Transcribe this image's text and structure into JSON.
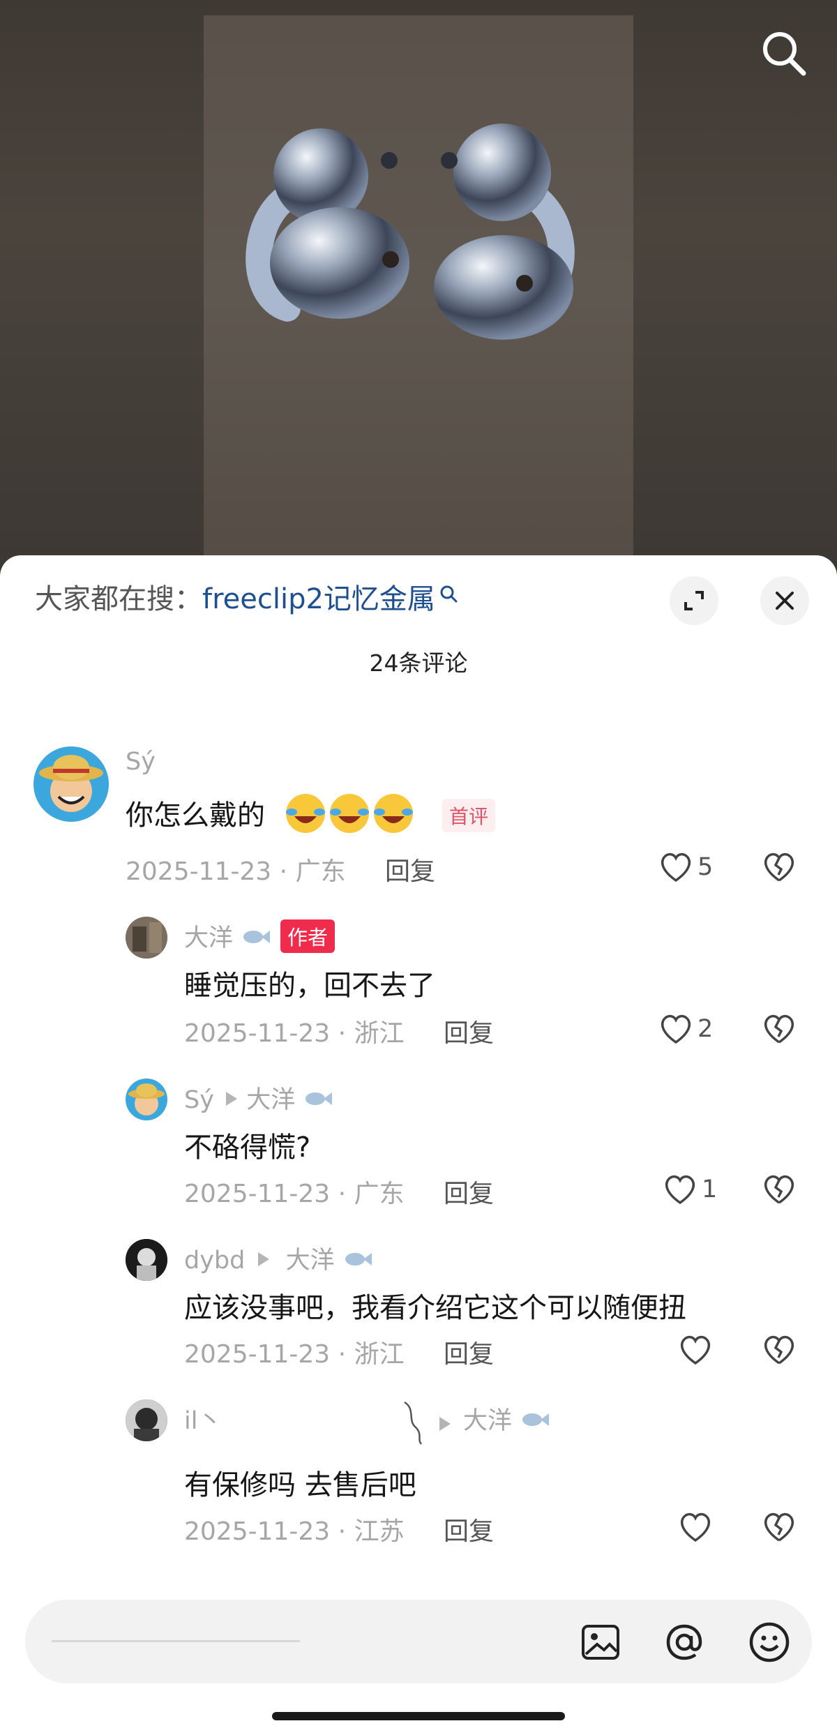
{
  "header": {
    "hot_search_prefix": "大家都在搜：",
    "hot_search_query": "freeclip2记忆金属",
    "comment_count": "24条评论"
  },
  "comments": [
    {
      "user": "Sý",
      "text": "你怎么戴的",
      "tag": "首评",
      "date": "2025-11-23",
      "location": "广东",
      "reply": "回复",
      "likes": "5"
    },
    {
      "user": "大洋",
      "tag": "作者",
      "text": "睡觉压的，回不去了",
      "date": "2025-11-23",
      "location": "浙江",
      "reply": "回复",
      "likes": "2"
    },
    {
      "user": "Sý",
      "reply_to": "大洋",
      "text": "不硌得慌?",
      "date": "2025-11-23",
      "location": "广东",
      "reply": "回复",
      "likes": "1"
    },
    {
      "user": "dybd",
      "reply_to": "大洋",
      "text": "应该没事吧，我看介绍它这个可以随便扭",
      "date": "2025-11-23",
      "location": "浙江",
      "reply": "回复",
      "likes": ""
    },
    {
      "user": "il丶",
      "reply_to": "大洋",
      "text": "有保修吗 去售后吧",
      "date": "2025-11-23",
      "location": "江苏",
      "reply": "回复",
      "likes": ""
    }
  ],
  "separator": "·",
  "icons": {
    "search": "search-icon",
    "expand": "expand-icon",
    "close": "close-icon",
    "like": "heart-icon",
    "dislike": "broken-heart-icon",
    "image": "image-icon",
    "mention": "at-icon",
    "emoji": "smile-icon",
    "fish": "fish-icon"
  },
  "colors": {
    "accent_link": "#1e4f8e",
    "author_tag": "#ef2c4c",
    "first_tag": "#e0536b"
  }
}
